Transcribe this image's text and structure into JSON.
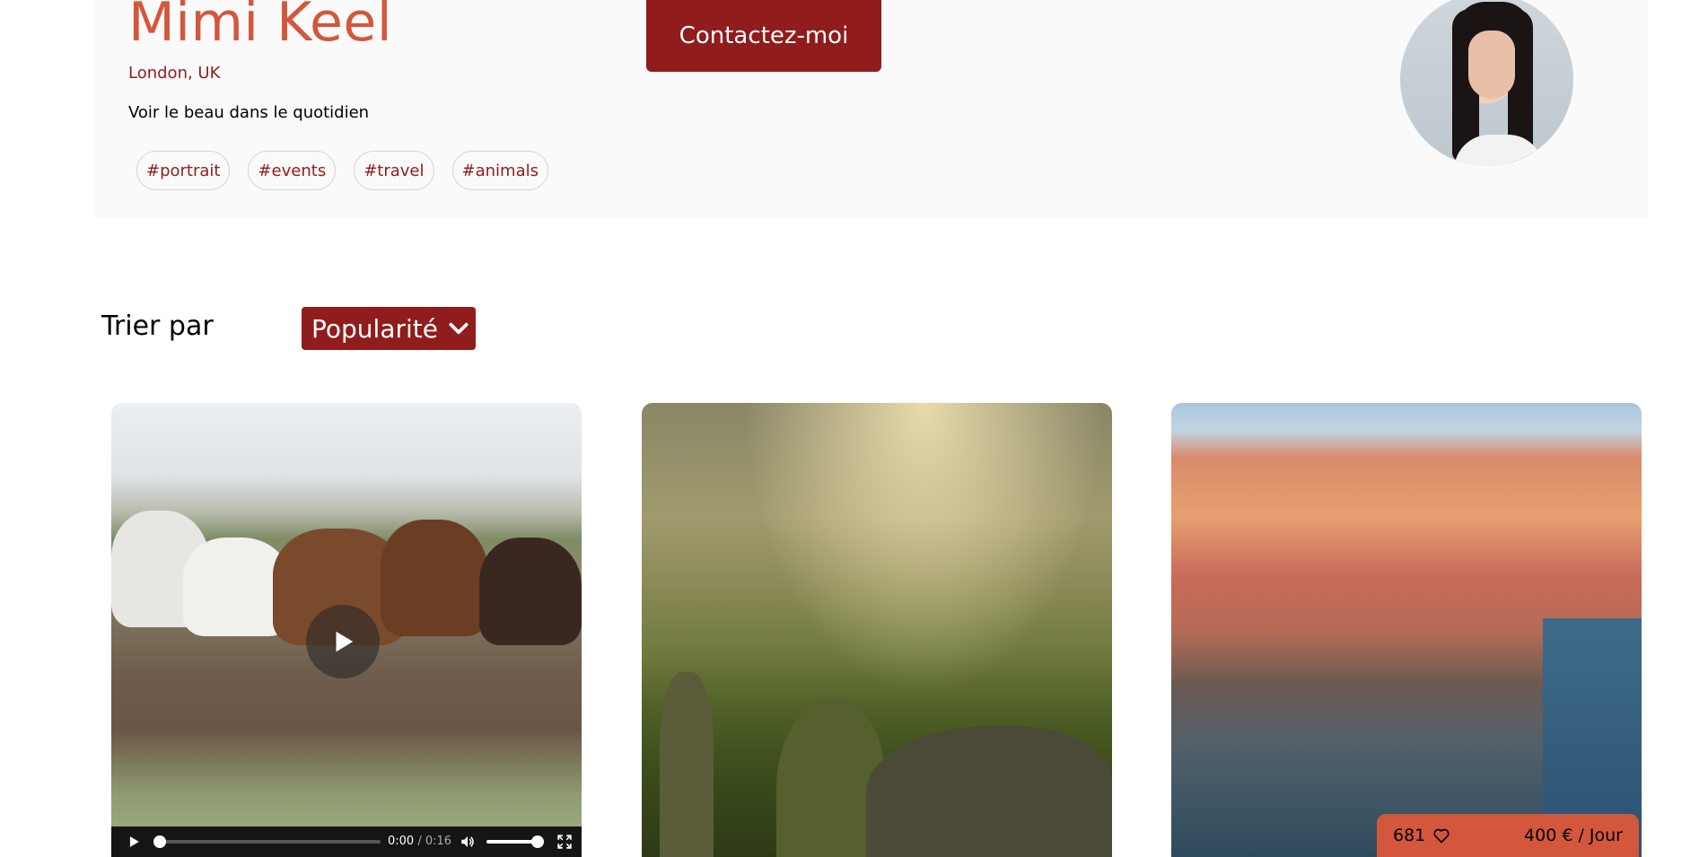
{
  "profile": {
    "name": "Mimi Keel",
    "location": "London, UK",
    "tagline": "Voir le beau dans le quotidien",
    "contact_label": "Contactez-moi",
    "tags": [
      "#portrait",
      "#events",
      "#travel",
      "#animals"
    ]
  },
  "sort": {
    "label": "Trier par",
    "selected": "Popularité"
  },
  "media": {
    "video": {
      "current_time": "0:00",
      "separator": "/",
      "duration": "0:16"
    },
    "card3": {
      "likes": "681",
      "price": "400 € / Jour"
    }
  },
  "colors": {
    "brand_dark": "#901c1c",
    "brand_accent": "#d3573c",
    "header_bg": "#fafafa"
  },
  "icons": {
    "sort": "chevron-down-icon",
    "play": "play-icon",
    "volume": "volume-icon",
    "fullscreen": "fullscreen-icon",
    "like": "heart-icon"
  }
}
